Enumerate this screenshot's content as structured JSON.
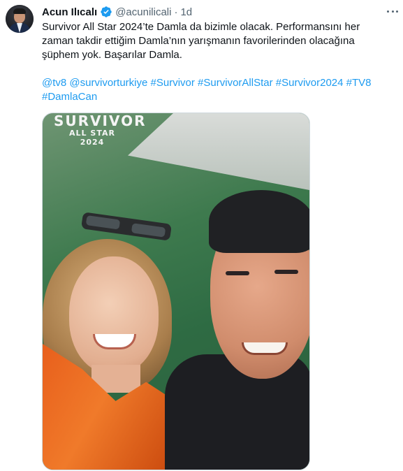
{
  "tweet": {
    "author_name": "Acun Ilıcalı",
    "handle": "@acunilicali",
    "separator": "·",
    "time": "1d",
    "text_lines": [
      "Survivor All Star 2024’te Damla da bizimle olacak. Performansını her",
      "zaman takdir ettiğim Damla’nın yarışmanın favorilerinden olacağına",
      "şüphem yok. Başarılar Damla."
    ],
    "tags": [
      "@tv8",
      "@survivorturkiye",
      "#Survivor",
      "#SurvivorAllStar",
      "#Survivor2024",
      "#TV8",
      "#DamlaCan"
    ]
  },
  "media": {
    "logo_line1": "SURVIVOR",
    "logo_line2": "ALL STAR",
    "logo_line3": "2024"
  },
  "icons": {
    "verified": "verified-badge-icon",
    "more": "more-options-icon"
  },
  "colors": {
    "link": "#1d9bf0",
    "verified": "#1d9bf0",
    "secondary_text": "#536471"
  }
}
